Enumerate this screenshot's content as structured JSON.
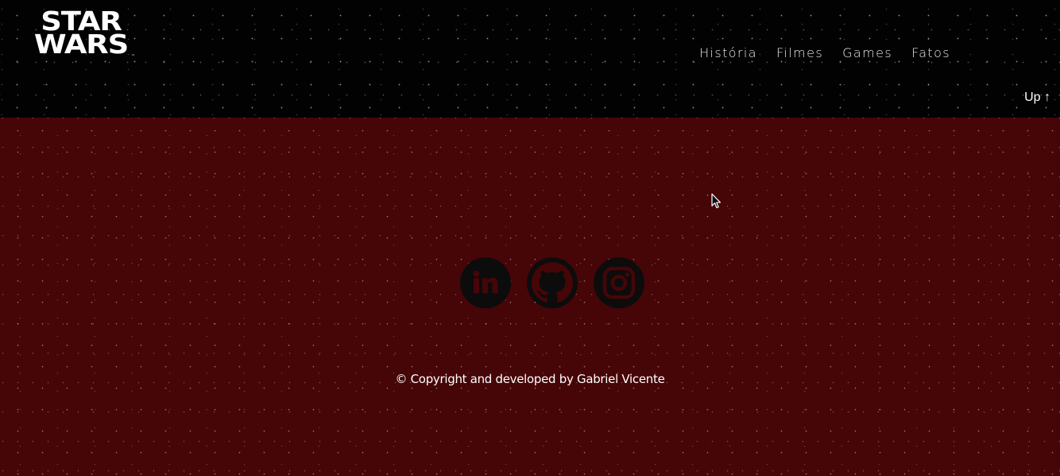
{
  "header": {
    "logo": {
      "line1": "STAR",
      "line2": "WARS",
      "tm": "™"
    },
    "nav": [
      {
        "label": "História"
      },
      {
        "label": "Filmes"
      },
      {
        "label": "Games"
      },
      {
        "label": "Fatos"
      }
    ],
    "up_label": "Up ↑"
  },
  "footer": {
    "socials": [
      {
        "icon": "linkedin-icon"
      },
      {
        "icon": "github-icon"
      },
      {
        "icon": "instagram-icon"
      }
    ],
    "copyright": "© Copyright and developed by Gabriel Vicente"
  },
  "colors": {
    "header_bg": "#020202",
    "footer_bg": "#460507",
    "icon_bg": "#0c0c0c",
    "icon_glyph": "#460507",
    "text": "#ffffff"
  }
}
